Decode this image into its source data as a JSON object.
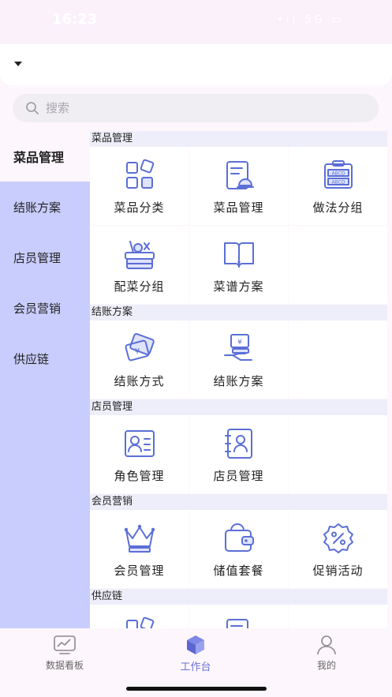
{
  "status_bar": {
    "time": "16:23",
    "icons": "•ıl 5G ▭"
  },
  "search": {
    "placeholder": "搜索"
  },
  "sidebar": {
    "items": [
      {
        "label": "菜品管理",
        "active": true
      },
      {
        "label": "结账方案"
      },
      {
        "label": "店员管理"
      },
      {
        "label": "会员营销"
      },
      {
        "label": "供应链"
      }
    ]
  },
  "sections": [
    {
      "title": "菜品管理",
      "items": [
        {
          "label": "菜品分类",
          "icon": "category-icon"
        },
        {
          "label": "菜品管理",
          "icon": "dish-list-icon"
        },
        {
          "label": "做法分组",
          "icon": "abcd-board-icon"
        },
        {
          "label": "配菜分组",
          "icon": "vegetable-basket-icon"
        },
        {
          "label": "菜谱方案",
          "icon": "recipe-book-icon"
        }
      ]
    },
    {
      "title": "结账方案",
      "items": [
        {
          "label": "结账方式",
          "icon": "payment-cards-icon"
        },
        {
          "label": "结账方案",
          "icon": "cash-hand-icon"
        }
      ]
    },
    {
      "title": "店员管理",
      "items": [
        {
          "label": "角色管理",
          "icon": "id-card-icon"
        },
        {
          "label": "店员管理",
          "icon": "staff-book-icon"
        }
      ]
    },
    {
      "title": "会员营销",
      "items": [
        {
          "label": "会员管理",
          "icon": "crown-icon"
        },
        {
          "label": "储值套餐",
          "icon": "wallet-icon"
        },
        {
          "label": "促销活动",
          "icon": "discount-badge-icon"
        }
      ]
    },
    {
      "title": "供应链",
      "items": []
    }
  ],
  "tabbar": {
    "items": [
      {
        "label": "数据看板",
        "icon": "chart-board-icon"
      },
      {
        "label": "工作台",
        "icon": "workbench-cube-icon",
        "active": true
      },
      {
        "label": "我的",
        "icon": "user-icon"
      }
    ]
  },
  "colors": {
    "accent": "#5b6fd6",
    "sidebar_bg": "#c9cdfd",
    "page_bg": "#fdf6fc"
  }
}
